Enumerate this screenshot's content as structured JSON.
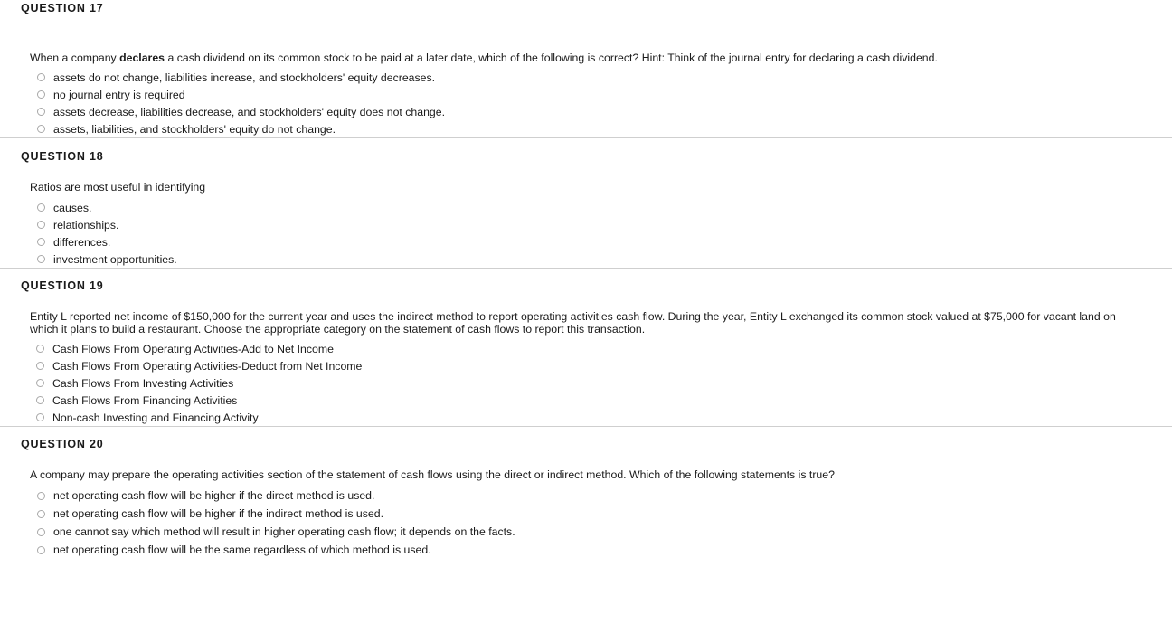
{
  "questions": [
    {
      "header": "QUESTION 17",
      "prompt_before_bold": "When a company ",
      "prompt_bold": "declares",
      "prompt_after_bold": " a cash dividend on its common stock to be paid at a later date, which of the following is correct?  Hint:  Think of the journal entry for declaring a cash dividend.",
      "options": [
        "assets do not change, liabilities increase, and stockholders' equity decreases.",
        "no journal entry is required",
        "assets decrease, liabilities decrease, and stockholders' equity does not change.",
        "assets, liabilities, and stockholders' equity do not change."
      ]
    },
    {
      "header": "QUESTION 18",
      "prompt": "Ratios are most useful in identifying",
      "options": [
        "causes.",
        "relationships.",
        "differences.",
        "investment opportunities."
      ]
    },
    {
      "header": "QUESTION 19",
      "prompt": "Entity L reported net income of $150,000 for the current year and uses the indirect method to report operating activities cash flow. During the year, Entity L exchanged its common stock valued at $75,000 for vacant land on which it plans to build a restaurant. Choose the appropriate category on the statement of cash flows to report this transaction.",
      "options": [
        "Cash Flows From Operating Activities-Add to Net Income",
        "Cash Flows From Operating Activities-Deduct from Net Income",
        "Cash Flows From Investing Activities",
        "Cash Flows From Financing Activities",
        "Non-cash Investing and Financing Activity"
      ]
    },
    {
      "header": "QUESTION 20",
      "prompt": "A company may prepare the operating activities section of the statement of cash flows using the direct or indirect method. Which of the following statements is true?",
      "options": [
        "net operating cash flow will be higher if the direct method is used.",
        "net operating cash flow will be higher if the indirect method is used.",
        "one cannot say which method will result in higher operating cash flow; it depends on the facts.",
        "net operating cash flow will be the same regardless of which method is used."
      ]
    }
  ],
  "colors": {
    "divider": "#cfcfcf",
    "text": "#1a1a1a",
    "radio_border": "#a8a8a8"
  }
}
